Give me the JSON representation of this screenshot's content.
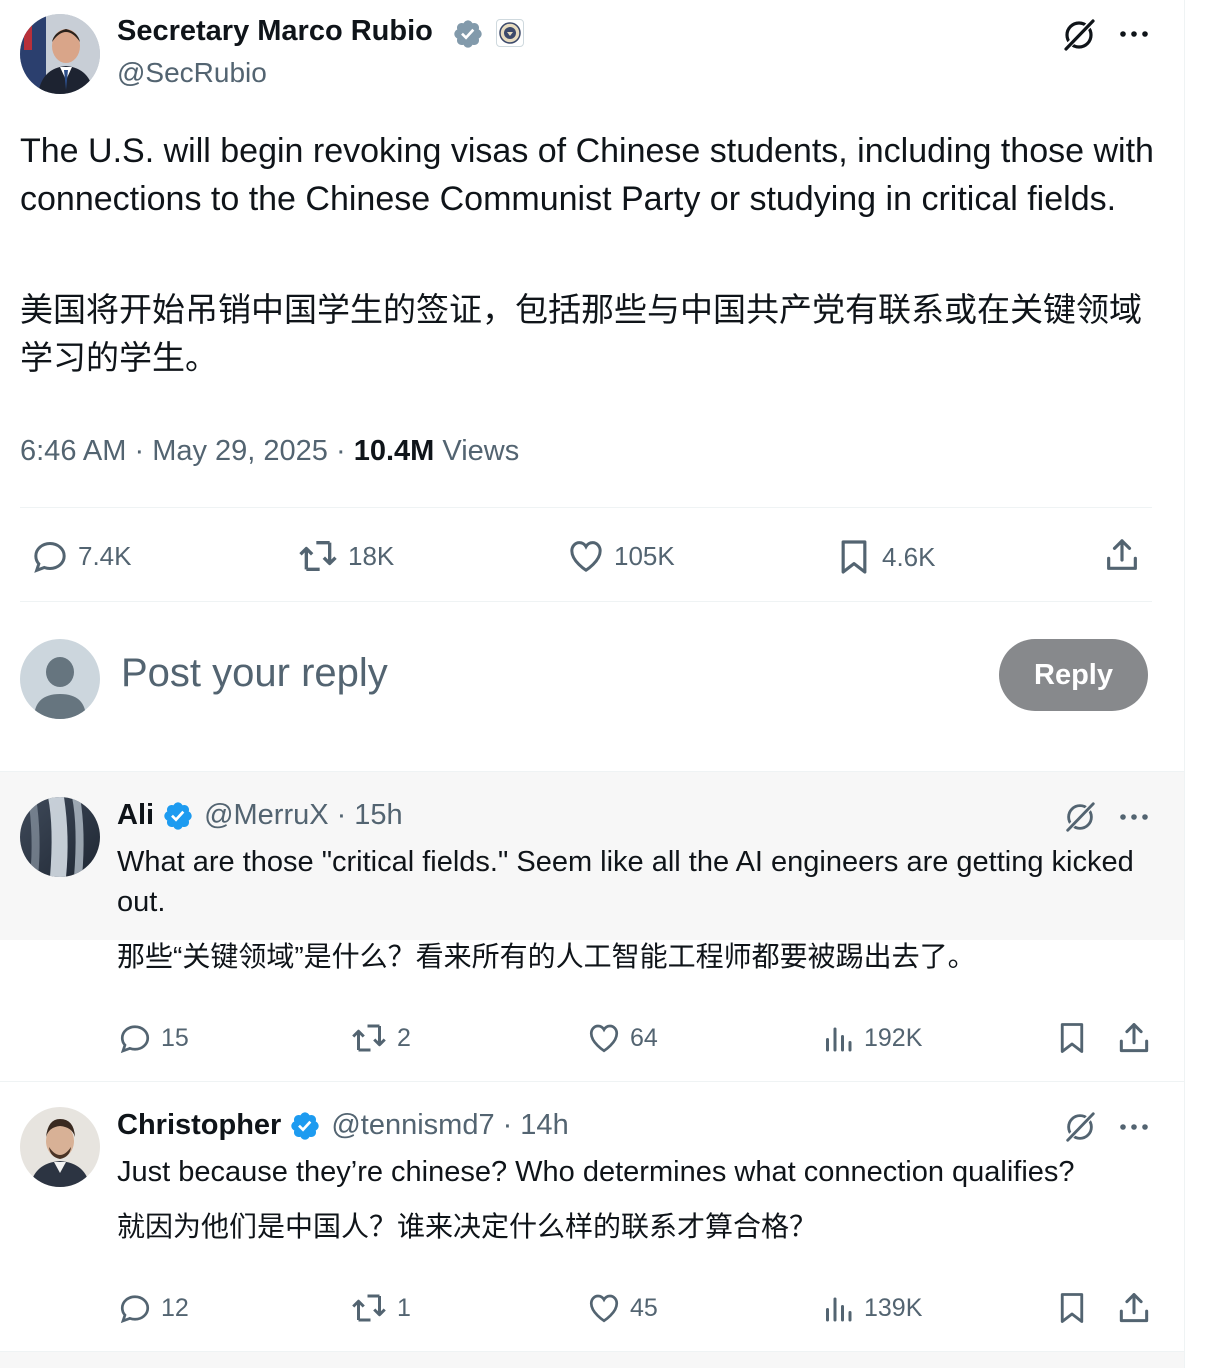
{
  "post": {
    "author_name": "Secretary Marco Rubio",
    "handle": "@SecRubio",
    "text_en": "The U.S. will begin revoking visas of Chinese students, including those with connections to the Chinese Communist Party or studying in critical fields.",
    "text_zh": "美国将开始吊销中国学生的签证，包括那些与中国共产党有联系或在关键领域学习的学生。",
    "time": "6:46 AM",
    "dot": "·",
    "date": "May 29, 2025",
    "views_count": "10.4M",
    "views_label": "Views",
    "stats": {
      "replies": "7.4K",
      "reposts": "18K",
      "likes": "105K",
      "bookmarks": "4.6K"
    }
  },
  "composer": {
    "placeholder": "Post your reply",
    "button": "Reply"
  },
  "replies": [
    {
      "name": "Ali",
      "handle": "@MerruX",
      "meta": "· 15h",
      "text_en": "What are those \"critical fields.\" Seem like all the AI engineers are getting kicked out.",
      "text_zh": "那些“关键领域”是什么？看来所有的人工智能工程师都要被踢出去了。",
      "replies": "15",
      "reposts": "2",
      "likes": "64",
      "views": "192K"
    },
    {
      "name": "Christopher",
      "handle": "@tennismd7",
      "meta": "· 14h",
      "text_en": "Just because they’re chinese? Who determines what connection qualifies?",
      "text_zh": "就因为他们是中国人？谁来决定什么样的联系才算合格？",
      "replies": "12",
      "reposts": "1",
      "likes": "45",
      "views": "139K"
    }
  ],
  "colors": {
    "verified": "#1d9bf0",
    "muted": "#536471",
    "reply_button": "#87898c",
    "highlight_bg": "#f7f7f7"
  }
}
